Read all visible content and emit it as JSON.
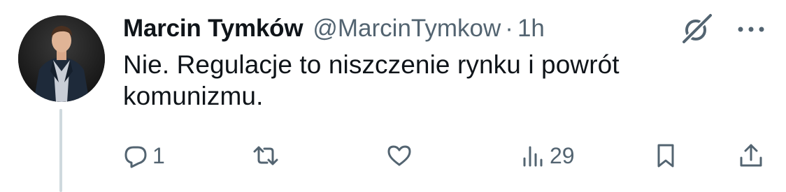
{
  "tweet": {
    "author": {
      "display_name": "Marcin Tymków",
      "handle": "@MarcinTymkow",
      "avatar": "profile-photo"
    },
    "separator": "·",
    "time": "1h",
    "text": "Nie. Regulacje to niszczenie rynku i powrót komunizmu."
  },
  "header_icons": {
    "grok": "grok-icon",
    "more": "more-icon"
  },
  "actions": {
    "reply": {
      "icon": "reply-icon",
      "count": "1"
    },
    "retweet": {
      "icon": "retweet-icon",
      "count": ""
    },
    "like": {
      "icon": "heart-icon",
      "count": ""
    },
    "views": {
      "icon": "views-icon",
      "count": "29"
    },
    "bookmark": {
      "icon": "bookmark-icon"
    },
    "share": {
      "icon": "share-icon"
    }
  },
  "colors": {
    "text_primary": "#0f1419",
    "text_secondary": "#536471",
    "thread_line": "#cfd9de",
    "background": "#ffffff"
  }
}
